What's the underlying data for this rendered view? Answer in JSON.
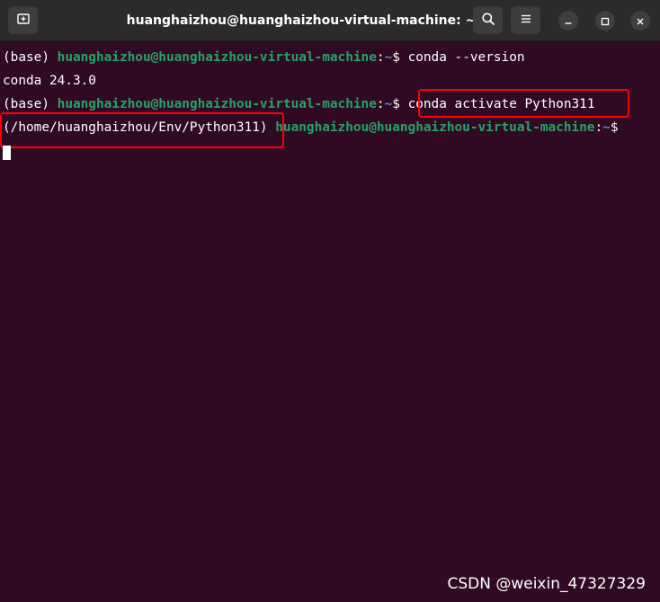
{
  "window": {
    "title": "huanghaizhou@huanghaizhou-virtual-machine: ~"
  },
  "titlebar": {
    "new_tab_icon": "new-tab-icon",
    "search_icon": "search-icon",
    "menu_icon": "hamburger-menu-icon",
    "minimize_icon": "minimize-icon",
    "maximize_icon": "maximize-icon",
    "close_icon": "close-icon"
  },
  "terminal": {
    "lines": [
      {
        "env": "(base) ",
        "userhost": "huanghaizhou@huanghaizhou-virtual-machine",
        "sep": ":",
        "path": "~",
        "prompt": "$ ",
        "command": "conda --version"
      },
      {
        "output": "conda 24.3.0"
      },
      {
        "env": "(base) ",
        "userhost": "huanghaizhou@huanghaizhou-virtual-machine",
        "sep": ":",
        "path": "~",
        "prompt": "$ ",
        "command": "conda activate Python311"
      },
      {
        "env": "(/home/huanghaizhou/Env/Python311) ",
        "userhost": "huanghaizhou@huanghaizhou-virtual-machine",
        "sep": ":",
        "path": "~",
        "prompt": "$"
      }
    ]
  },
  "watermark": "CSDN @weixin_47327329",
  "colors": {
    "terminal_bg": "#300a24",
    "titlebar_bg": "#2b2b2b",
    "prompt_green": "#26a269",
    "highlight_red": "#ff0000"
  }
}
